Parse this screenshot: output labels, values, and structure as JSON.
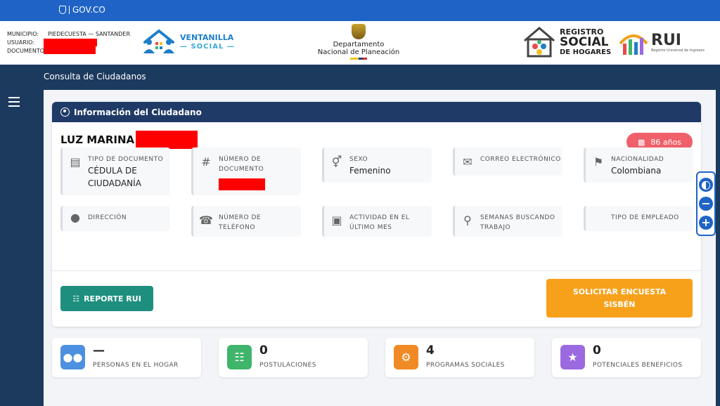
{
  "gov_bar": {
    "logo_text": "GOV.CO"
  },
  "header": {
    "municipio_label": "MUNICIPIO:",
    "municipio_value": "PIEDECUESTA — SANTANDER",
    "usuario_label": "USUARIO:",
    "documento_label": "DOCUMENTO:",
    "ventanilla_line1": "VENTANILLA",
    "ventanilla_line2": "— SOCIAL —",
    "dnp_line1": "Departamento",
    "dnp_line2": "Nacional de Planeación",
    "rsh_line1": "REGISTRO",
    "rsh_line2": "SOCIAL",
    "rsh_line3": "DE HOGARES",
    "rui_text": "RUI",
    "rui_sub": "Registro Universal de Ingresos"
  },
  "subheader": {
    "title": "Consulta de Ciudadanos"
  },
  "card": {
    "header_title": "Información del Ciudadano",
    "citizen_name": "LUZ MARINA",
    "age_badge": "86 años",
    "fields": [
      {
        "icon": "id-card-icon",
        "label": "TIPO DE DOCUMENTO",
        "value": "CÉDULA DE CIUDADANÍA"
      },
      {
        "icon": "hash-icon",
        "label": "NÚMERO DE DOCUMENTO",
        "value": ""
      },
      {
        "icon": "gender-icon",
        "label": "SEXO",
        "value": "Femenino"
      },
      {
        "icon": "envelope-icon",
        "label": "CORREO ELECTRÓNICO",
        "value": ""
      },
      {
        "icon": "flag-icon",
        "label": "NACIONALIDAD",
        "value": "Colombiana"
      },
      {
        "icon": "map-pin-icon",
        "label": "DIRECCIÓN",
        "value": ""
      },
      {
        "icon": "phone-icon",
        "label": "NÚMERO DE TELÉFONO",
        "value": ""
      },
      {
        "icon": "briefcase-icon",
        "label": "ACTIVIDAD EN EL ÚLTIMO MES",
        "value": ""
      },
      {
        "icon": "search-icon",
        "label": "SEMANAS BUSCANDO TRABAJO",
        "value": ""
      },
      {
        "icon": "",
        "label": "TIPO DE EMPLEADO",
        "value": ""
      }
    ],
    "btn_reporte": "REPORTE RUI",
    "btn_sisben": "SOLICITAR ENCUESTA SISBÉN"
  },
  "stats": [
    {
      "value": "—",
      "label": "PERSONAS EN EL HOGAR",
      "color": "#4d8fe0",
      "icon": "people-icon"
    },
    {
      "value": "0",
      "label": "POSTULACIONES",
      "color": "#3fb56b",
      "icon": "document-icon"
    },
    {
      "value": "4",
      "label": "PROGRAMAS SOCIALES",
      "color": "#f08a24",
      "icon": "gear-icon"
    },
    {
      "value": "0",
      "label": "POTENCIALES BENEFICIOS",
      "color": "#9b6ae0",
      "icon": "star-icon"
    }
  ],
  "colors": {
    "gov_blue": "#1f63c6",
    "navy": "#1c3a5e",
    "card_header": "#1f3a66",
    "teal_button": "#1e8f7e",
    "orange_button": "#f7a11a",
    "age_badge": "#f0606a"
  }
}
